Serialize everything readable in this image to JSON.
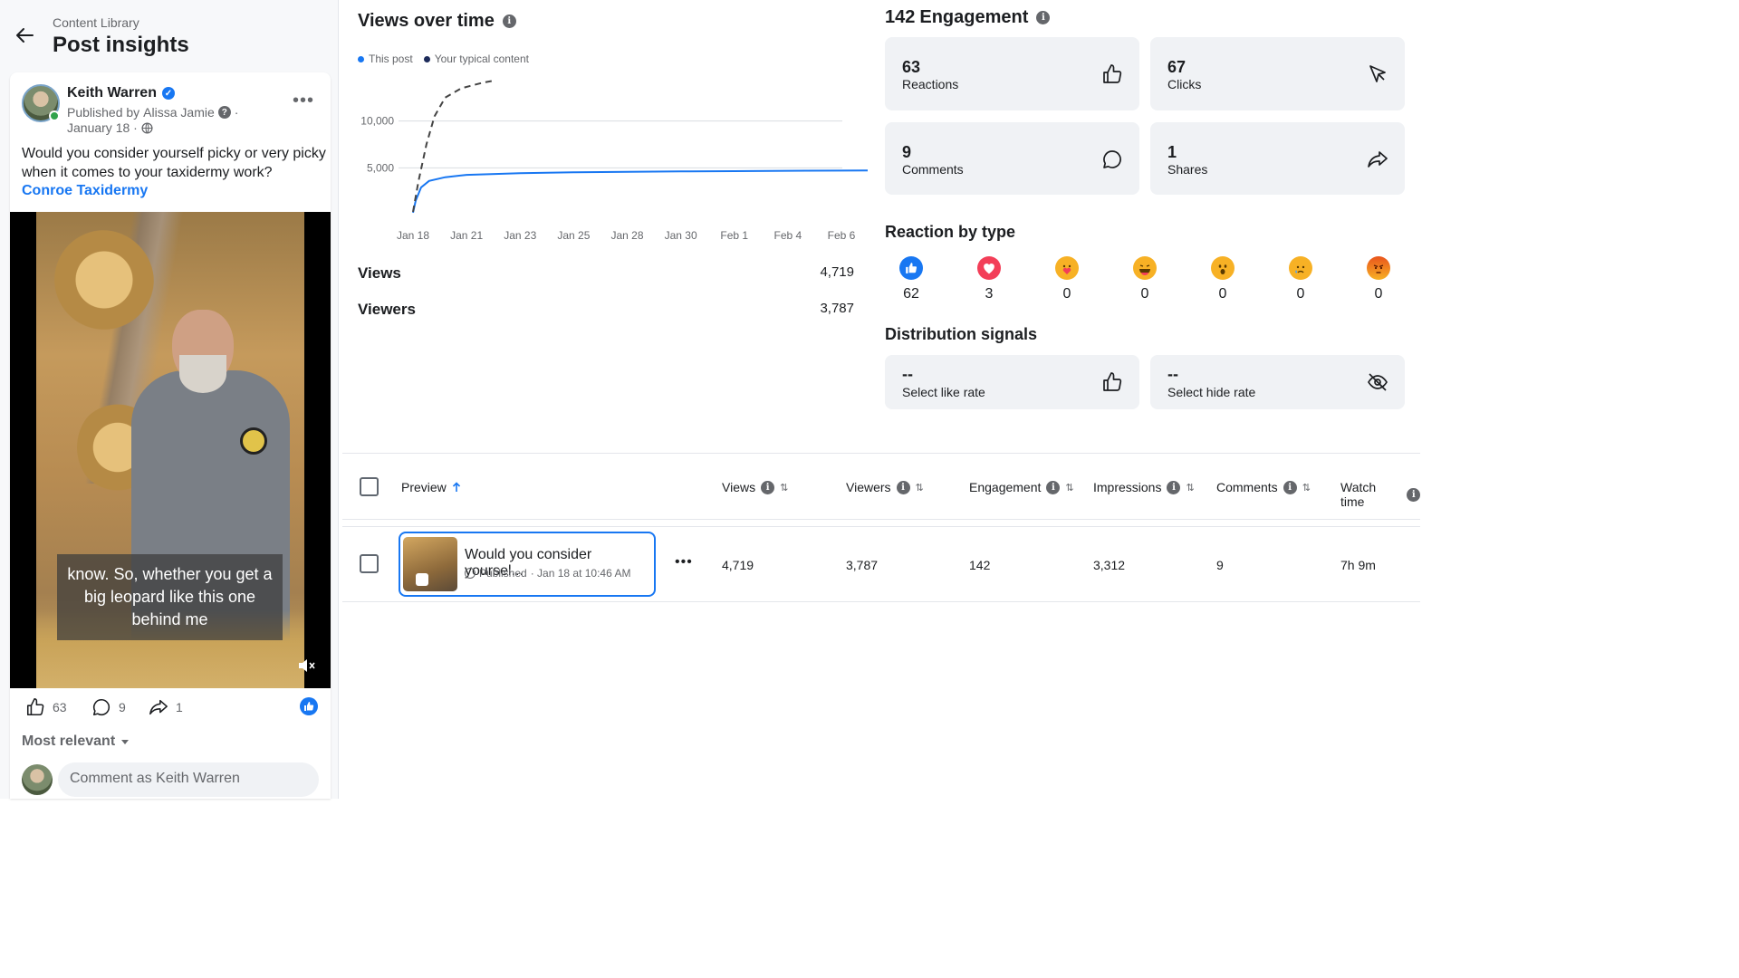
{
  "header": {
    "breadcrumb": "Content Library",
    "title": "Post insights"
  },
  "post": {
    "author": "Keith Warren",
    "published_by_prefix": "Published by",
    "published_by": "Alissa Jamie",
    "published_by_suffix": "·",
    "date": "January 18 ·",
    "text": "Would you consider yourself picky or very picky when it comes to  your taxidermy work?",
    "link": "Conroe Taxidermy",
    "video_caption": "know. So, whether you get a big leopard like this one behind me",
    "reactions_count": "63",
    "comments_count": "9",
    "shares_count": "1",
    "sort_label": "Most relevant",
    "comment_placeholder": "Comment as Keith Warren"
  },
  "views": {
    "title": "Views over time",
    "legend": [
      {
        "label": "This post",
        "color": "#1877f2"
      },
      {
        "label": "Your typical content",
        "color": "#1c2b5a"
      }
    ],
    "views_label": "Views",
    "views_value": "4,719",
    "viewers_label": "Viewers",
    "viewers_value": "3,787"
  },
  "chart_data": {
    "type": "line",
    "x": [
      "Jan 18",
      "Jan 21",
      "Jan 23",
      "Jan 25",
      "Jan 28",
      "Jan 30",
      "Feb 1",
      "Feb 4",
      "Feb 6"
    ],
    "yticks": [
      5000,
      10000
    ],
    "ytick_labels": [
      "5,000",
      "10,000"
    ],
    "ylim": [
      0,
      15000
    ],
    "series": [
      {
        "name": "This post",
        "color": "#1877f2",
        "style": "solid",
        "points": [
          [
            0,
            200
          ],
          [
            0.05,
            1500
          ],
          [
            0.15,
            2900
          ],
          [
            0.3,
            3600
          ],
          [
            0.6,
            4000
          ],
          [
            1,
            4250
          ],
          [
            2,
            4430
          ],
          [
            3,
            4520
          ],
          [
            4,
            4580
          ],
          [
            5,
            4620
          ],
          [
            6,
            4650
          ],
          [
            7,
            4680
          ],
          [
            8,
            4700
          ],
          [
            9,
            4719
          ]
        ]
      },
      {
        "name": "Your typical content",
        "color": "#444",
        "style": "dashed",
        "points": [
          [
            0,
            300
          ],
          [
            0.1,
            3500
          ],
          [
            0.25,
            7500
          ],
          [
            0.4,
            10500
          ],
          [
            0.6,
            12500
          ],
          [
            0.9,
            13500
          ],
          [
            1.3,
            14100
          ],
          [
            1.5,
            14300
          ]
        ]
      }
    ]
  },
  "engagement": {
    "total": "142",
    "title_suffix": "Engagement",
    "tiles": [
      {
        "value": "63",
        "label": "Reactions",
        "icon": "thumbs-up-icon"
      },
      {
        "value": "67",
        "label": "Clicks",
        "icon": "cursor-icon"
      },
      {
        "value": "9",
        "label": "Comments",
        "icon": "comment-icon"
      },
      {
        "value": "1",
        "label": "Shares",
        "icon": "share-icon"
      }
    ],
    "reaction_title": "Reaction by type",
    "reactions": [
      {
        "type": "like",
        "count": "62",
        "color": "#1877f2"
      },
      {
        "type": "love",
        "count": "3",
        "color": "#f33e58"
      },
      {
        "type": "care",
        "count": "0",
        "color": "#f7b125"
      },
      {
        "type": "haha",
        "count": "0",
        "color": "#f7b125"
      },
      {
        "type": "wow",
        "count": "0",
        "color": "#f7b125"
      },
      {
        "type": "sad",
        "count": "0",
        "color": "#f7b125"
      },
      {
        "type": "angry",
        "count": "0",
        "color": "#e9541c"
      }
    ],
    "distribution_title": "Distribution signals",
    "signals": [
      {
        "value": "--",
        "label": "Select like rate",
        "icon": "thumbs-up-icon"
      },
      {
        "value": "--",
        "label": "Select hide rate",
        "icon": "eye-off-icon"
      }
    ]
  },
  "table": {
    "columns": [
      "Preview",
      "Views",
      "Viewers",
      "Engagement",
      "Impressions",
      "Comments",
      "Watch time"
    ],
    "row": {
      "title": "Would you consider yoursel...",
      "status": "Published",
      "published_at": "· Jan 18 at 10:46 AM",
      "views": "4,719",
      "viewers": "3,787",
      "engagement": "142",
      "impressions": "3,312",
      "comments": "9",
      "watch_time": "7h 9m"
    }
  }
}
